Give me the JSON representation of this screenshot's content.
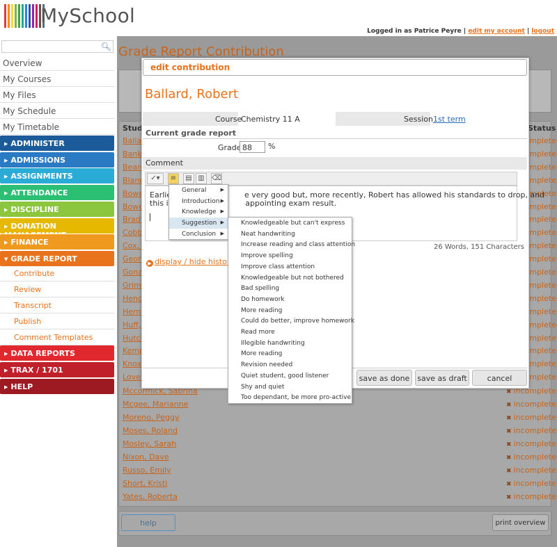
{
  "header": {
    "logo_text": "MySchool",
    "logo_colors": [
      "#e53935",
      "#fb8c00",
      "#fdd835",
      "#7cb342",
      "#43a047",
      "#26a69a",
      "#1e88e5",
      "#3949ab",
      "#8e24aa",
      "#d81b60",
      "#6d4c41",
      "#546e7a"
    ],
    "logged_in_text": "Logged in as Patrice Peyre",
    "separator": "|",
    "edit_account": "edit my account",
    "logout": "logout"
  },
  "sidebar": {
    "search_placeholder": "",
    "plain_items": [
      "Overview",
      "My Courses",
      "My Files",
      "My Schedule",
      "My Timetable"
    ],
    "sections": [
      {
        "label": "ADMINISTER",
        "color": "#1c5b9a"
      },
      {
        "label": "ADMISSIONS",
        "color": "#2a7bc4"
      },
      {
        "label": "ASSIGNMENTS",
        "color": "#2aabd6"
      },
      {
        "label": "ATTENDANCE",
        "color": "#2bbf74"
      },
      {
        "label": "DISCIPLINE",
        "color": "#8cc63e"
      },
      {
        "label": "DONATION MANAGEMENT",
        "color": "#e6b800"
      },
      {
        "label": "FINANCE",
        "color": "#ef9a1f"
      },
      {
        "label": "GRADE REPORT",
        "color": "#e8731c"
      }
    ],
    "grade_report_subitems": [
      "Contribute",
      "Review",
      "Transcript",
      "Publish",
      "Comment Templates"
    ],
    "lower_sections": [
      {
        "label": "DATA REPORTS",
        "color": "#e0282e"
      },
      {
        "label": "TRAX / 1701",
        "color": "#c0202a"
      },
      {
        "label": "HELP",
        "color": "#9e1a22"
      }
    ]
  },
  "main": {
    "page_title": "Grade Report Contribution",
    "table_headers": {
      "student": "Stude",
      "status": "Status"
    },
    "truncated_rows": [
      "Ballar",
      "Banks",
      "Beard",
      "Blanc",
      "Bowe",
      "Bowe",
      "Bradfo",
      "Cobb,",
      "Cox, I",
      "Georg",
      "Gonza",
      "Grime",
      "Hende",
      "Herna",
      "Huff, I",
      "Hutch",
      "Kemp",
      "Knox,",
      "Love,"
    ],
    "full_rows": [
      "Mccormick, Sabrina",
      "Mcgee, Marianne",
      "Moreno, Peggy",
      "Moses, Roland",
      "Mosley, Sarah",
      "Nixon, Dave",
      "Russo, Emily",
      "Short, Kristi",
      "Yates, Roberta"
    ],
    "status_text": "incomplete",
    "help_button": "help",
    "print_button": "print overview"
  },
  "dialog": {
    "title": "edit contribution",
    "student_name": "Ballard, Robert",
    "course_label": "Course",
    "course_value": "Chemistry 11 A",
    "session_label": "Session",
    "session_value": "1st term",
    "current_grade_report": "Current grade report",
    "grade_label": "Grade",
    "grade_value": "88",
    "grade_unit": "%",
    "comment_label": "Comment",
    "editor_text_line1": "Earlie                              e very good but, more recently, Robert has allowed his standards to drop, and",
    "editor_text_line2": "this is                              appointing exam result.",
    "word_count": "26 Words, 151 Characters",
    "history_link": "display / hide history",
    "buttons": {
      "save_done": "save as done",
      "save_draft": "save as draft",
      "cancel": "cancel"
    }
  },
  "menu1": {
    "items": [
      "General",
      "Introduction",
      "Knowledge",
      "Suggestion",
      "Conclusion"
    ],
    "active": "Suggestion"
  },
  "menu2": {
    "items": [
      "Knowledgeable but can't express",
      "Neat handwriting",
      "Increase reading and class attention",
      "Improve spelling",
      "Improve class attention",
      "Knowledgeable but not bothered",
      "Bad spelling",
      "Do homework",
      "More reading",
      "Could do better, improve homework",
      "Read more",
      "Illegible handwriting",
      "More reading",
      "Revision needed",
      "Quiet student, good listener",
      "Shy and quiet",
      "Too dependant, be more pro-active"
    ]
  }
}
